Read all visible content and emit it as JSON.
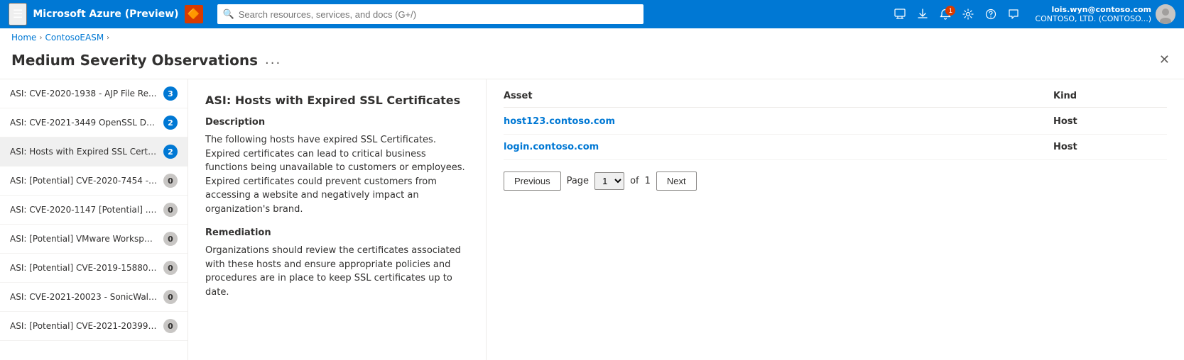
{
  "topnav": {
    "hamburger": "☰",
    "title": "Microsoft Azure (Preview)",
    "icon": "🔶",
    "search_placeholder": "Search resources, services, and docs (G+/)",
    "user_name": "lois.wyn@contoso.com",
    "user_org": "CONTOSO, LTD. (CONTOSO...)",
    "notification_count": "1",
    "icons": {
      "monitor": "⬜",
      "download": "⬇",
      "bell": "🔔",
      "gear": "⚙",
      "help": "?",
      "feedback": "💬"
    }
  },
  "breadcrumb": {
    "items": [
      "Home",
      "ContosoEASM"
    ],
    "separators": [
      ">",
      ">"
    ]
  },
  "page": {
    "title": "Medium Severity Observations",
    "more_label": "..."
  },
  "sidebar": {
    "items": [
      {
        "label": "ASI: CVE-2020-1938 - AJP File Re...",
        "count": "3",
        "zero": false,
        "active": false
      },
      {
        "label": "ASI: CVE-2021-3449 OpenSSL De...",
        "count": "2",
        "zero": false,
        "active": false
      },
      {
        "label": "ASI: Hosts with Expired SSL Certifi...",
        "count": "2",
        "zero": false,
        "active": true
      },
      {
        "label": "ASI: [Potential] CVE-2020-7454 - ...",
        "count": "0",
        "zero": true,
        "active": false
      },
      {
        "label": "ASI: CVE-2020-1147 [Potential] .N...",
        "count": "0",
        "zero": true,
        "active": false
      },
      {
        "label": "ASI: [Potential] VMware Workspac...",
        "count": "0",
        "zero": true,
        "active": false
      },
      {
        "label": "ASI: [Potential] CVE-2019-15880 -...",
        "count": "0",
        "zero": true,
        "active": false
      },
      {
        "label": "ASI: CVE-2021-20023 - SonicWall ...",
        "count": "0",
        "zero": true,
        "active": false
      },
      {
        "label": "ASI: [Potential] CVE-2021-20399 -...",
        "count": "0",
        "zero": true,
        "active": false
      }
    ]
  },
  "detail": {
    "title": "ASI: Hosts with Expired SSL Certificates",
    "description_label": "Description",
    "description_text": "The following hosts have expired SSL Certificates. Expired certificates can lead to critical business functions being unavailable to customers or employees. Expired certificates could prevent customers from accessing a website and negatively impact an organization's brand.",
    "remediation_label": "Remediation",
    "remediation_text": "Organizations should review the certificates associated with these hosts and ensure appropriate policies and procedures are in place to keep SSL certificates up to date."
  },
  "table": {
    "col_asset": "Asset",
    "col_kind": "Kind",
    "rows": [
      {
        "asset": "host123.contoso.com",
        "kind": "Host"
      },
      {
        "asset": "login.contoso.com",
        "kind": "Host"
      }
    ]
  },
  "pagination": {
    "previous_label": "Previous",
    "next_label": "Next",
    "page_label": "Page",
    "of_label": "of",
    "current_page": "1",
    "total_pages": "1"
  }
}
